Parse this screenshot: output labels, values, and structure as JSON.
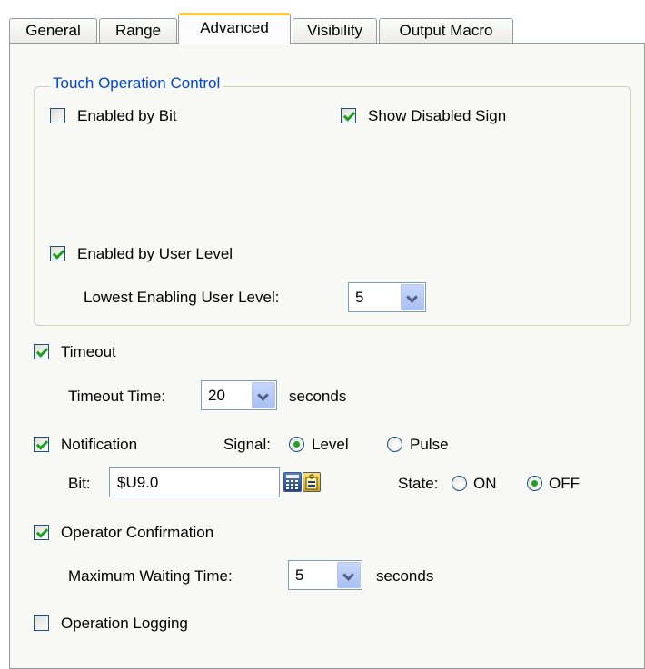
{
  "tabs": [
    {
      "label": "General",
      "active": false
    },
    {
      "label": "Range",
      "active": false
    },
    {
      "label": "Advanced",
      "active": true
    },
    {
      "label": "Visibility",
      "active": false
    },
    {
      "label": "Output Macro",
      "active": false
    }
  ],
  "touch_group": {
    "legend": "Touch Operation Control",
    "enabled_by_bit": {
      "label": "Enabled by Bit",
      "checked": false
    },
    "show_disabled_sign": {
      "label": "Show Disabled Sign",
      "checked": true
    },
    "enabled_by_user_level": {
      "label": "Enabled by User Level",
      "checked": true
    },
    "lowest_level_label": "Lowest Enabling User Level:",
    "lowest_level_value": "5"
  },
  "timeout": {
    "label": "Timeout",
    "checked": true,
    "time_label": "Timeout Time:",
    "time_value": "20",
    "unit": "seconds"
  },
  "notification": {
    "label": "Notification",
    "checked": true,
    "signal_label": "Signal:",
    "signal_options": [
      "Level",
      "Pulse"
    ],
    "signal_selected": "Level",
    "bit_label": "Bit:",
    "bit_value": "$U9.0",
    "state_label": "State:",
    "state_options": [
      "ON",
      "OFF"
    ],
    "state_selected": "OFF"
  },
  "operator_confirmation": {
    "label": "Operator Confirmation",
    "checked": true,
    "wait_label": "Maximum Waiting Time:",
    "wait_value": "5",
    "unit": "seconds"
  },
  "operation_logging": {
    "label": "Operation Logging",
    "checked": false
  },
  "colors": {
    "accent_tab": "#ffc83c",
    "check": "#21a121",
    "legend": "#0046d5"
  }
}
